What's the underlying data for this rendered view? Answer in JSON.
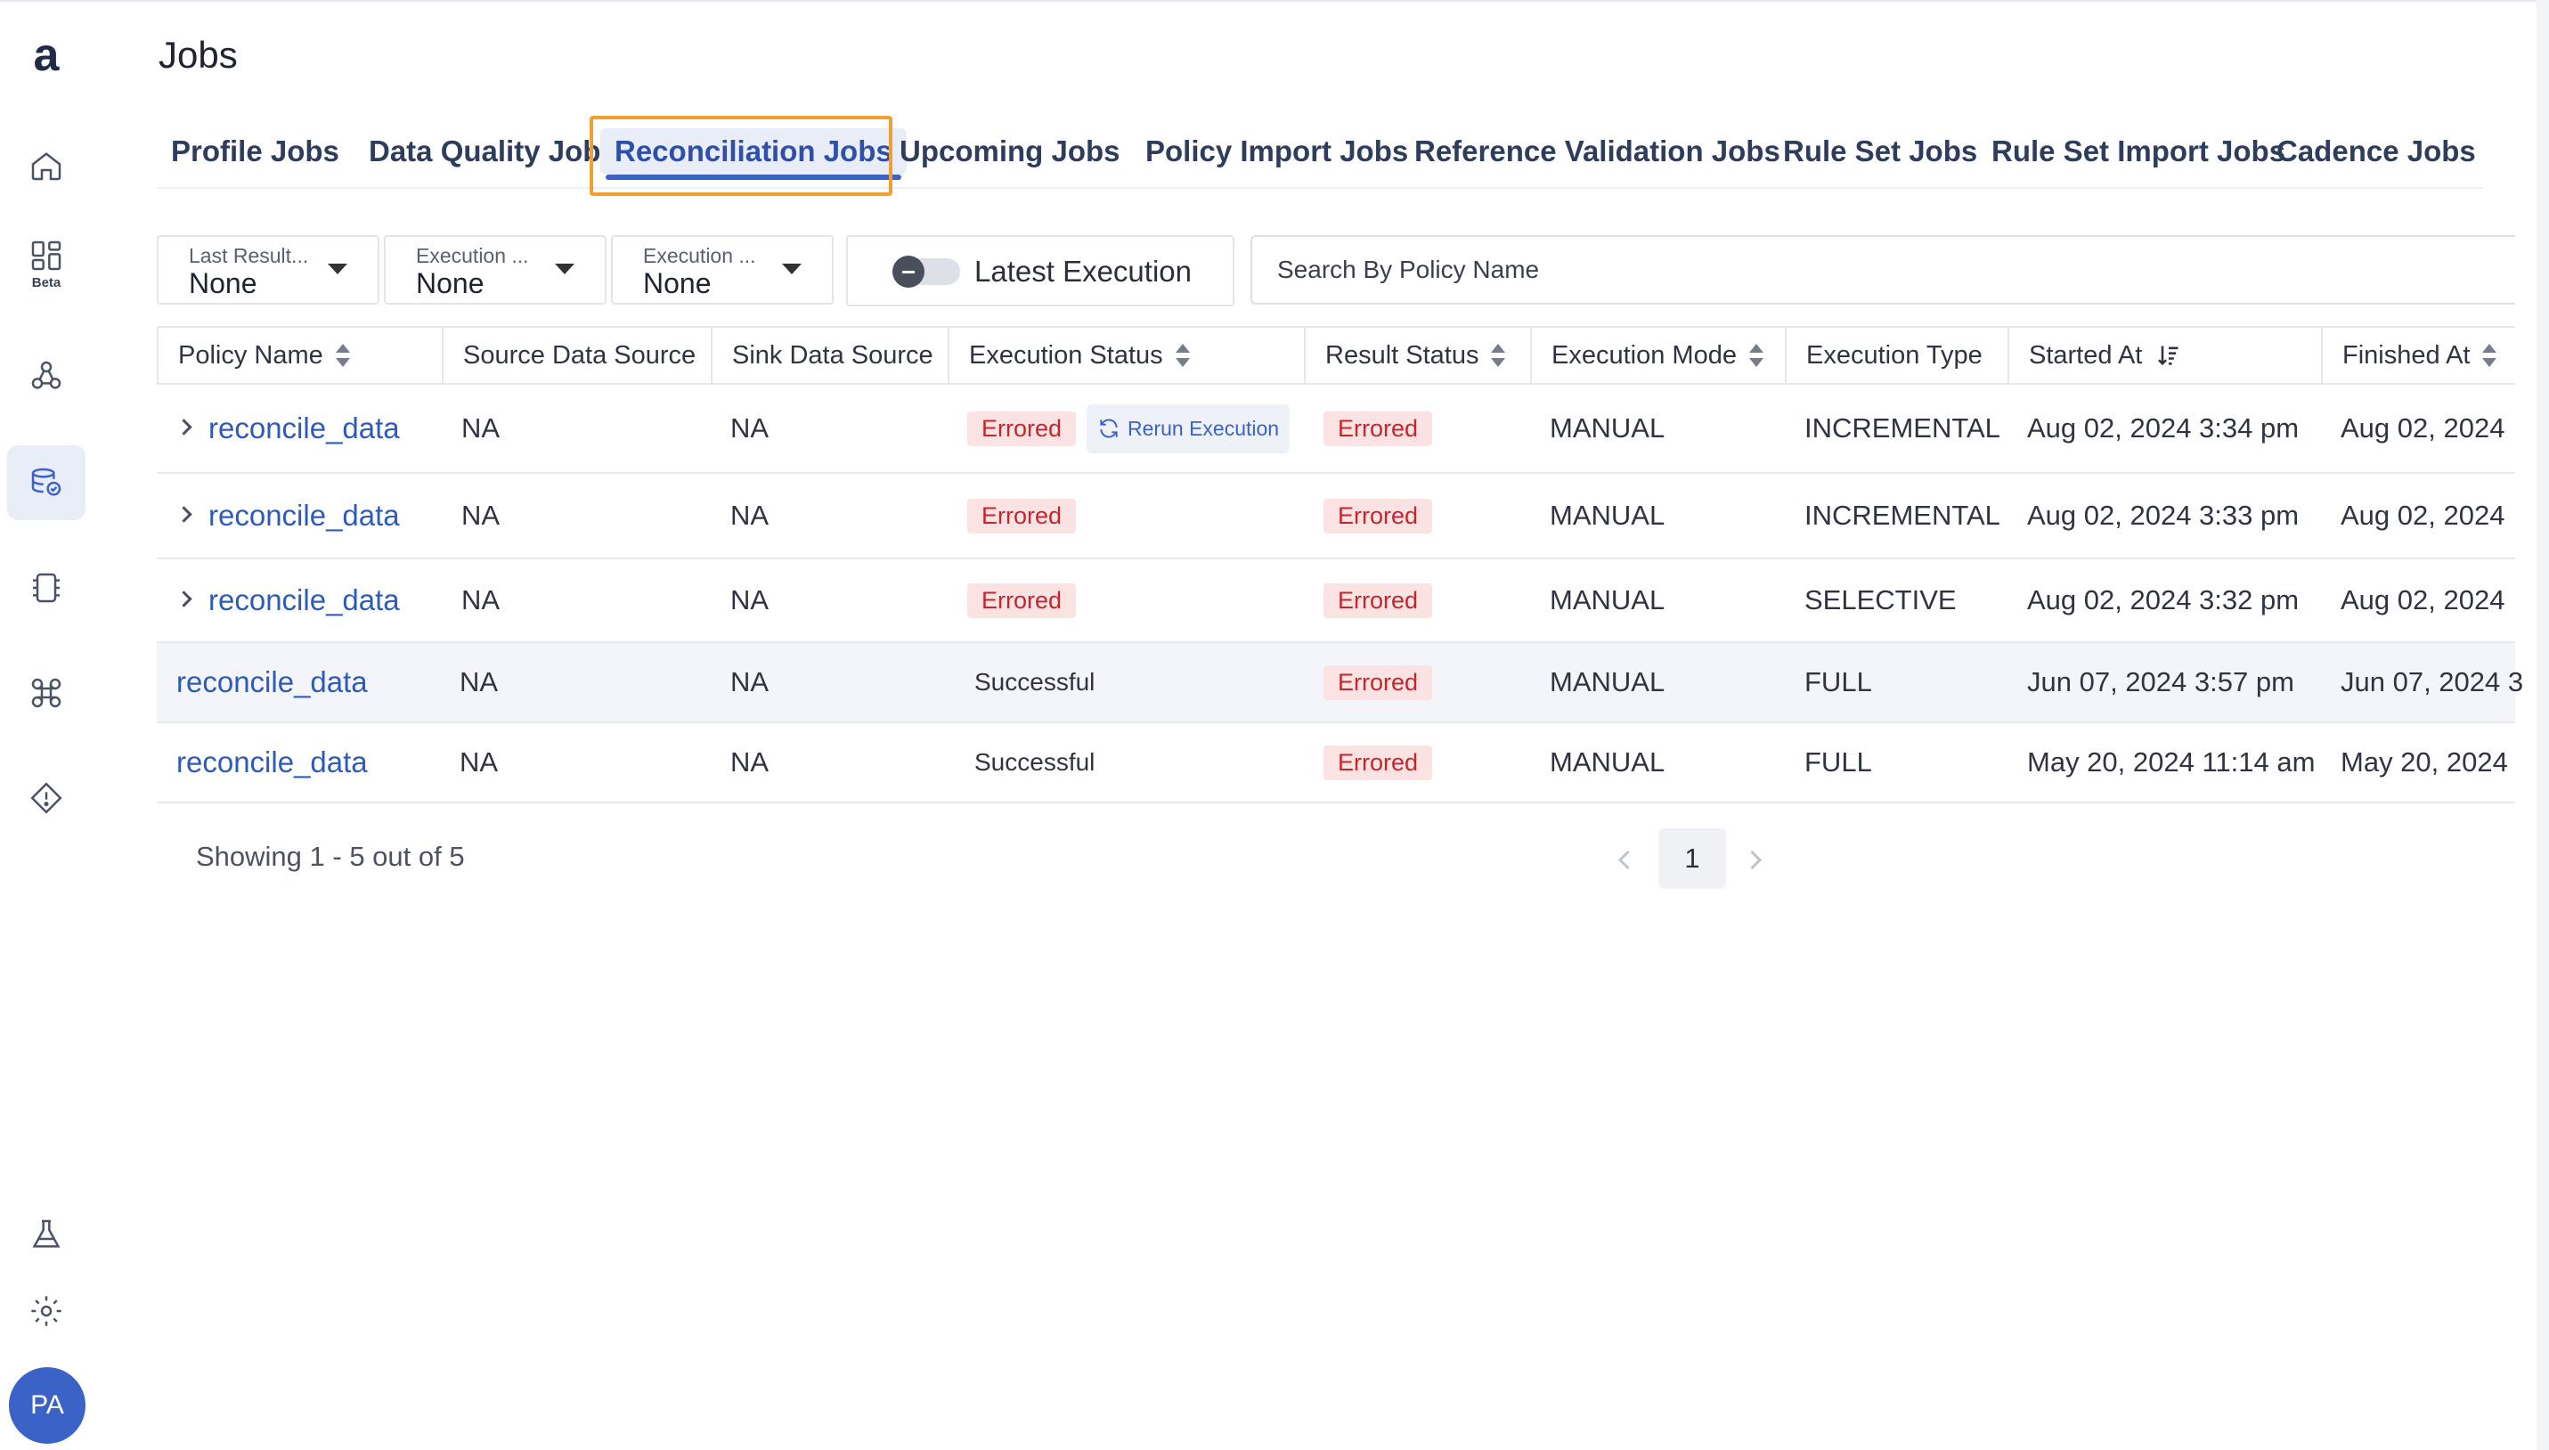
{
  "page": {
    "title": "Jobs"
  },
  "sidebar": {
    "logo_letter": "a",
    "beta_label": "Beta",
    "avatar_initials": "PA"
  },
  "tabs": [
    {
      "label": "Profile Jobs"
    },
    {
      "label": "Data Quality Jobs"
    },
    {
      "label": "Reconciliation Jobs",
      "active": true
    },
    {
      "label": "Upcoming Jobs"
    },
    {
      "label": "Policy Import Jobs"
    },
    {
      "label": "Reference Validation Jobs"
    },
    {
      "label": "Rule Set Jobs"
    },
    {
      "label": "Rule Set Import Jobs"
    },
    {
      "label": "Cadence Jobs"
    }
  ],
  "filters": [
    {
      "label": "Last Result...",
      "value": "None"
    },
    {
      "label": "Execution ...",
      "value": "None"
    },
    {
      "label": "Execution ...",
      "value": "None"
    }
  ],
  "toggle": {
    "label": "Latest Execution",
    "on": false
  },
  "search": {
    "placeholder": "Search By Policy Name",
    "value": ""
  },
  "table": {
    "columns": [
      "Policy Name",
      "Source Data Source",
      "Sink Data Source",
      "Execution Status",
      "Result Status",
      "Execution Mode",
      "Execution Type",
      "Started At",
      "Finished At"
    ],
    "rows": [
      {
        "policy": "reconcile_data",
        "source": "NA",
        "sink": "NA",
        "exec_status": "Errored",
        "rerun": "Rerun Execution",
        "result": "Errored",
        "mode": "MANUAL",
        "type": "INCREMENTAL",
        "started": "Aug 02, 2024 3:34 pm",
        "finished": "Aug 02, 2024"
      },
      {
        "policy": "reconcile_data",
        "source": "NA",
        "sink": "NA",
        "exec_status": "Errored",
        "result": "Errored",
        "mode": "MANUAL",
        "type": "INCREMENTAL",
        "started": "Aug 02, 2024 3:33 pm",
        "finished": "Aug 02, 2024"
      },
      {
        "policy": "reconcile_data",
        "source": "NA",
        "sink": "NA",
        "exec_status": "Errored",
        "result": "Errored",
        "mode": "MANUAL",
        "type": "SELECTIVE",
        "started": "Aug 02, 2024 3:32 pm",
        "finished": "Aug 02, 2024"
      },
      {
        "policy": "reconcile_data",
        "source": "NA",
        "sink": "NA",
        "exec_status": "Successful",
        "result": "Errored",
        "mode": "MANUAL",
        "type": "FULL",
        "started": "Jun 07, 2024 3:57 pm",
        "finished": "Jun 07, 2024 3"
      },
      {
        "policy": "reconcile_data",
        "source": "NA",
        "sink": "NA",
        "exec_status": "Successful",
        "result": "Errored",
        "mode": "MANUAL",
        "type": "FULL",
        "started": "May 20, 2024 11:14 am",
        "finished": "May 20, 2024"
      }
    ]
  },
  "pagination": {
    "summary": "Showing 1 - 5 out of 5",
    "current_page": "1"
  },
  "colors": {
    "accent": "#3b63c7",
    "error_bg": "#fbe3e4",
    "error_text": "#c2272d",
    "tab_highlight": "#f0a030"
  }
}
